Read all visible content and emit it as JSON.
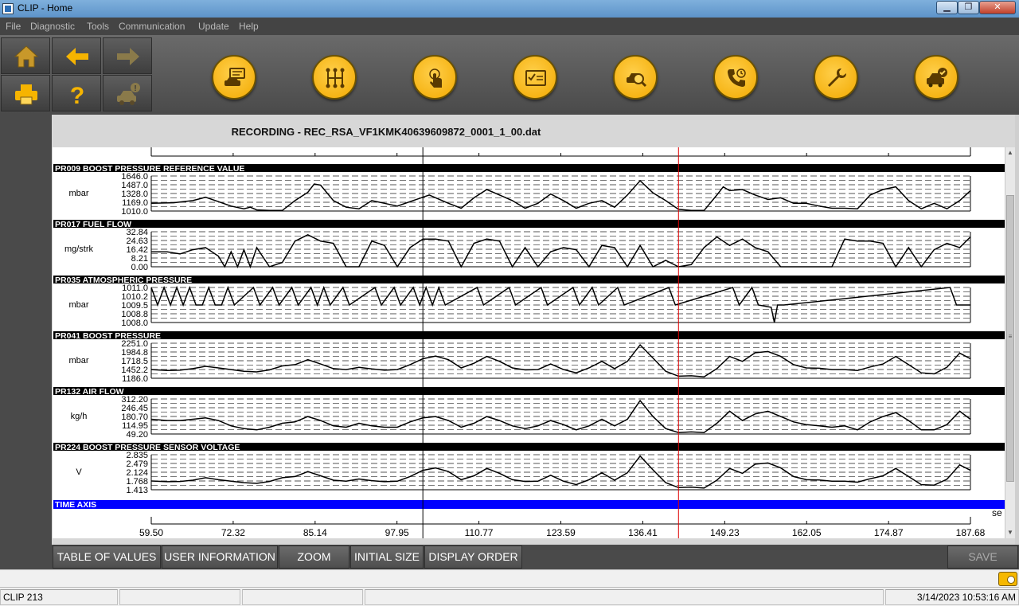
{
  "window": {
    "title": "CLIP - Home",
    "min_label": "▁",
    "max_label": "❐",
    "close_label": "✕"
  },
  "menu": [
    "File",
    "Diagnostic",
    "Tools",
    "Communication",
    "Update",
    "Help"
  ],
  "toolbar": {
    "nav_icons": [
      "home-icon",
      "arrow-left-icon",
      "arrow-right-icon",
      "printer-icon",
      "help-icon",
      "vehicle-alert-icon"
    ],
    "circle_icons": [
      "vehicle-id-icon",
      "ecu-network-icon",
      "touch-icon",
      "checklist-icon",
      "vehicle-search-icon",
      "phone-support-icon",
      "wrench-icon",
      "vehicle-check-icon"
    ]
  },
  "recording": {
    "title": "RECORDING - REC_RSA_VF1KMK40639609872_0001_1_00.dat"
  },
  "chart_data": {
    "type": "line",
    "cursor_x": 142.0,
    "marker_x": 102.0,
    "time_axis": {
      "label": "TIME AXIS",
      "unit_label": "se",
      "ticks": [
        "59.50",
        "72.32",
        "85.14",
        "97.95",
        "110.77",
        "123.59",
        "136.41",
        "149.23",
        "162.05",
        "174.87",
        "187.68"
      ],
      "xlim": [
        59.5,
        187.68
      ]
    },
    "series": [
      {
        "name": "PR009  BOOST PRESSURE REFERENCE VALUE",
        "unit": "mbar",
        "ticks": [
          "1646.0",
          "1487.0",
          "1328.0",
          "1169.0",
          "1010.0"
        ],
        "ylim": [
          1010,
          1646
        ],
        "x": [
          59.5,
          63,
          66,
          68,
          70,
          72,
          74,
          75,
          76,
          78,
          80,
          82,
          84,
          85,
          86,
          88,
          90,
          92,
          94,
          96,
          98,
          100,
          103,
          106,
          108,
          110,
          112,
          114,
          116,
          118,
          120,
          122,
          124,
          126,
          128,
          130,
          132,
          134,
          136,
          138,
          140,
          142,
          144,
          146,
          148,
          149,
          150,
          152,
          154,
          156,
          158,
          160,
          162,
          164,
          166,
          168,
          170,
          172,
          174,
          176,
          178,
          180,
          182,
          184,
          186,
          187.68
        ],
        "values": [
          1150,
          1160,
          1200,
          1260,
          1180,
          1100,
          1050,
          1080,
          1030,
          1020,
          1020,
          1200,
          1350,
          1500,
          1480,
          1200,
          1080,
          1050,
          1200,
          1150,
          1100,
          1180,
          1300,
          1150,
          1060,
          1250,
          1400,
          1300,
          1200,
          1060,
          1150,
          1320,
          1200,
          1060,
          1150,
          1200,
          1080,
          1300,
          1560,
          1340,
          1200,
          1040,
          1020,
          1020,
          1300,
          1450,
          1380,
          1400,
          1300,
          1220,
          1250,
          1150,
          1150,
          1100,
          1060,
          1060,
          1050,
          1300,
          1400,
          1450,
          1200,
          1050,
          1150,
          1050,
          1200,
          1380
        ]
      },
      {
        "name": "PR017  FUEL FLOW",
        "unit": "mg/strk",
        "ticks": [
          "32.84",
          "24.63",
          "16.42",
          "8.21",
          "0.00"
        ],
        "ylim": [
          0,
          32.84
        ],
        "x": [
          59.5,
          62,
          64,
          66,
          68,
          70,
          71,
          72,
          73,
          74,
          75,
          76,
          78,
          80,
          82,
          84,
          86,
          88,
          90,
          92,
          94,
          96,
          98,
          100,
          102,
          104,
          106,
          108,
          110,
          112,
          114,
          116,
          118,
          120,
          122,
          124,
          126,
          128,
          130,
          132,
          134,
          136,
          138,
          140,
          142,
          144,
          146,
          148,
          150,
          152,
          154,
          156,
          158,
          160,
          162,
          164,
          166,
          168,
          170,
          172,
          174,
          176,
          178,
          180,
          182,
          184,
          186,
          187.68
        ],
        "values": [
          14,
          14,
          12,
          16,
          18,
          10,
          0,
          14,
          0,
          16,
          0,
          18,
          0,
          4,
          24,
          30,
          24,
          22,
          0,
          0,
          24,
          20,
          0,
          18,
          26,
          26,
          24,
          0,
          22,
          26,
          24,
          0,
          18,
          0,
          14,
          18,
          16,
          0,
          20,
          18,
          0,
          20,
          0,
          6,
          0,
          2,
          18,
          28,
          20,
          26,
          18,
          14,
          0,
          0,
          0,
          0,
          0,
          26,
          24,
          24,
          22,
          0,
          18,
          0,
          16,
          22,
          18,
          28
        ]
      },
      {
        "name": "PR035  ATMOSPHERIC PRESSURE",
        "unit": "mbar",
        "ticks": [
          "1011.0",
          "1010.2",
          "1009.5",
          "1008.8",
          "1008.0"
        ],
        "ylim": [
          1008,
          1011
        ],
        "x": [
          59.5,
          60.5,
          61.5,
          62.5,
          63.5,
          64.5,
          65.5,
          66.5,
          67.5,
          68.5,
          69.5,
          70.5,
          71.5,
          72.5,
          75.5,
          76.5,
          78.5,
          79.5,
          81.5,
          82.5,
          84.5,
          85.5,
          86.5,
          87.5,
          89.5,
          90.5,
          94.5,
          95.5,
          97.5,
          98.5,
          100.5,
          101.5,
          102.5,
          103.5,
          104.5,
          105.5,
          110.5,
          111.5,
          115.5,
          116.5,
          120.5,
          121.5,
          125.5,
          126.5,
          128.5,
          129.5,
          132.5,
          133.5,
          140.5,
          141.5,
          150.5,
          151.5,
          153.5,
          154.5,
          156.5,
          157,
          157.5,
          158.5,
          184.5,
          185.5,
          187.68
        ],
        "values": [
          1011,
          1009.5,
          1011,
          1009.5,
          1011,
          1009.5,
          1011,
          1009.5,
          1009.5,
          1011,
          1009.5,
          1009.5,
          1011,
          1009.5,
          1011,
          1009.5,
          1011,
          1009.5,
          1011,
          1009.5,
          1011,
          1009.5,
          1011,
          1009.5,
          1011,
          1009.5,
          1011,
          1009.5,
          1011,
          1009.5,
          1011,
          1009.5,
          1011,
          1009.5,
          1011,
          1009.5,
          1011,
          1009.5,
          1011,
          1009.5,
          1011,
          1009.5,
          1011,
          1009.5,
          1011,
          1009.5,
          1011,
          1009.5,
          1011,
          1009.5,
          1011,
          1009.5,
          1011,
          1009.5,
          1009.3,
          1008,
          1009.5,
          1009.5,
          1011,
          1009.5,
          1009.5
        ]
      },
      {
        "name": "PR041  BOOST PRESSURE",
        "unit": "mbar",
        "ticks": [
          "2251.0",
          "1984.8",
          "1718.5",
          "1452.2",
          "1186.0"
        ],
        "ylim": [
          1186,
          2251
        ],
        "x": [
          59.5,
          62,
          64,
          66,
          68,
          70,
          72,
          74,
          76,
          78,
          80,
          82,
          84,
          86,
          88,
          90,
          92,
          94,
          96,
          98,
          100,
          102,
          104,
          106,
          108,
          110,
          112,
          114,
          116,
          118,
          120,
          122,
          124,
          126,
          128,
          130,
          132,
          134,
          136,
          138,
          140,
          142,
          144,
          146,
          148,
          150,
          152,
          154,
          156,
          158,
          160,
          162,
          164,
          166,
          168,
          170,
          172,
          174,
          176,
          178,
          180,
          182,
          184,
          186,
          187.68
        ],
        "values": [
          1450,
          1420,
          1430,
          1480,
          1550,
          1500,
          1450,
          1400,
          1380,
          1440,
          1560,
          1600,
          1750,
          1620,
          1480,
          1450,
          1520,
          1470,
          1430,
          1450,
          1600,
          1780,
          1860,
          1750,
          1500,
          1640,
          1850,
          1700,
          1500,
          1440,
          1450,
          1620,
          1450,
          1350,
          1500,
          1700,
          1480,
          1700,
          2200,
          1800,
          1400,
          1250,
          1260,
          1230,
          1480,
          1850,
          1700,
          1960,
          2000,
          1850,
          1600,
          1500,
          1490,
          1450,
          1450,
          1420,
          1530,
          1620,
          1850,
          1600,
          1350,
          1320,
          1520,
          1950,
          1780
        ]
      },
      {
        "name": "PR132  AIR FLOW",
        "unit": "kg/h",
        "ticks": [
          "312.20",
          "246.45",
          "180.70",
          "114.95",
          "49.20"
        ],
        "ylim": [
          49.2,
          312.2
        ],
        "x": [
          59.5,
          62,
          64,
          66,
          68,
          70,
          72,
          74,
          76,
          78,
          80,
          82,
          84,
          86,
          88,
          90,
          92,
          94,
          96,
          98,
          100,
          102,
          104,
          106,
          108,
          110,
          112,
          114,
          116,
          118,
          120,
          122,
          124,
          126,
          128,
          130,
          132,
          134,
          136,
          138,
          140,
          142,
          144,
          146,
          148,
          150,
          152,
          154,
          156,
          158,
          160,
          162,
          164,
          166,
          168,
          170,
          172,
          174,
          176,
          178,
          180,
          182,
          184,
          186,
          187.68
        ],
        "values": [
          160,
          150,
          150,
          160,
          170,
          150,
          110,
          90,
          80,
          100,
          130,
          140,
          180,
          150,
          110,
          100,
          130,
          110,
          100,
          100,
          140,
          170,
          180,
          150,
          100,
          130,
          180,
          150,
          110,
          90,
          110,
          150,
          120,
          80,
          110,
          160,
          110,
          160,
          300,
          180,
          90,
          60,
          65,
          60,
          130,
          220,
          150,
          200,
          220,
          180,
          140,
          120,
          110,
          100,
          110,
          80,
          140,
          180,
          210,
          150,
          80,
          80,
          120,
          220,
          160
        ]
      },
      {
        "name": "PR224  BOOST PRESSURE SENSOR VOLTAGE",
        "unit": "V",
        "ticks": [
          "2.835",
          "2.479",
          "2.124",
          "1.768",
          "1.413"
        ],
        "ylim": [
          1.413,
          2.835
        ],
        "x": [
          59.5,
          62,
          64,
          66,
          68,
          70,
          72,
          74,
          76,
          78,
          80,
          82,
          84,
          86,
          88,
          90,
          92,
          94,
          96,
          98,
          100,
          102,
          104,
          106,
          108,
          110,
          112,
          114,
          116,
          118,
          120,
          122,
          124,
          126,
          128,
          130,
          132,
          134,
          136,
          138,
          140,
          142,
          144,
          146,
          148,
          150,
          152,
          154,
          156,
          158,
          160,
          162,
          164,
          166,
          168,
          170,
          172,
          174,
          176,
          178,
          180,
          182,
          184,
          186,
          187.68
        ],
        "values": [
          1.77,
          1.74,
          1.75,
          1.8,
          1.9,
          1.82,
          1.76,
          1.7,
          1.67,
          1.75,
          1.9,
          1.95,
          2.15,
          1.98,
          1.8,
          1.76,
          1.85,
          1.78,
          1.74,
          1.76,
          1.95,
          2.2,
          2.3,
          2.15,
          1.82,
          1.98,
          2.28,
          2.08,
          1.82,
          1.75,
          1.76,
          2.0,
          1.76,
          1.62,
          1.82,
          2.1,
          1.8,
          2.1,
          2.78,
          2.22,
          1.7,
          1.5,
          1.52,
          1.48,
          1.8,
          2.28,
          2.08,
          2.45,
          2.5,
          2.3,
          1.95,
          1.82,
          1.81,
          1.76,
          1.76,
          1.72,
          1.86,
          1.98,
          2.28,
          1.95,
          1.62,
          1.6,
          1.84,
          2.42,
          2.2
        ]
      }
    ]
  },
  "bottom_buttons": [
    "TABLE OF VALUES",
    "USER INFORMATION",
    "ZOOM",
    "INITIAL SIZE",
    "DISPLAY ORDER"
  ],
  "save_label": "SAVE",
  "status": {
    "left": "CLIP 213",
    "datetime": "3/14/2023 10:53:16 AM"
  }
}
